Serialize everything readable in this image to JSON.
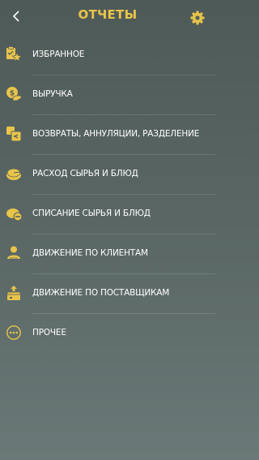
{
  "header": {
    "title": "ОТЧЕТЫ",
    "back_icon": "chevron-left-icon",
    "settings_icon": "gear-icon"
  },
  "colors": {
    "accent": "#e8c44a",
    "background_top": "#4e5a57",
    "background_bottom": "#6a7877",
    "text": "#ffffff"
  },
  "menu": {
    "items": [
      {
        "label": "ИЗБРАННОЕ",
        "icon": "favorites-icon"
      },
      {
        "label": "ВЫРУЧКА",
        "icon": "revenue-icon"
      },
      {
        "label": "ВОЗВРАТЫ, АННУЛЯЦИИ, РАЗДЕЛЕНИЕ",
        "icon": "returns-icon"
      },
      {
        "label": "РАСХОД СЫРЬЯ И БЛЮД",
        "icon": "consumption-icon"
      },
      {
        "label": "СПИСАНИЕ СЫРЬЯ И БЛЮД",
        "icon": "write-off-icon"
      },
      {
        "label": "ДВИЖЕНИЕ ПО КЛИЕНТАМ",
        "icon": "clients-icon"
      },
      {
        "label": "ДВИЖЕНИЕ ПО ПОСТАВЩИКАМ",
        "icon": "suppliers-icon"
      },
      {
        "label": "ПРОЧЕЕ",
        "icon": "more-icon"
      }
    ]
  }
}
